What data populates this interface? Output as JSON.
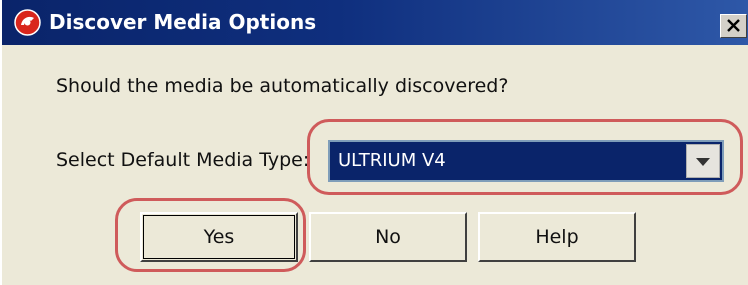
{
  "window": {
    "title": "Discover Media Options",
    "app_icon": "app-logo-icon",
    "close_icon": "close-icon"
  },
  "dialog": {
    "question": "Should the media be automatically discovered?",
    "select_label": "Select Default Media Type:",
    "media_type": {
      "selected": "ULTRIUM V4",
      "arrow_icon": "chevron-down-icon"
    }
  },
  "buttons": {
    "yes": "Yes",
    "no": "No",
    "help": "Help"
  },
  "colors": {
    "titlebar": "#0a246a",
    "highlight_annotation": "#cf5b5b",
    "dialog_background": "#ece9d8",
    "select_background": "#0a246a"
  }
}
